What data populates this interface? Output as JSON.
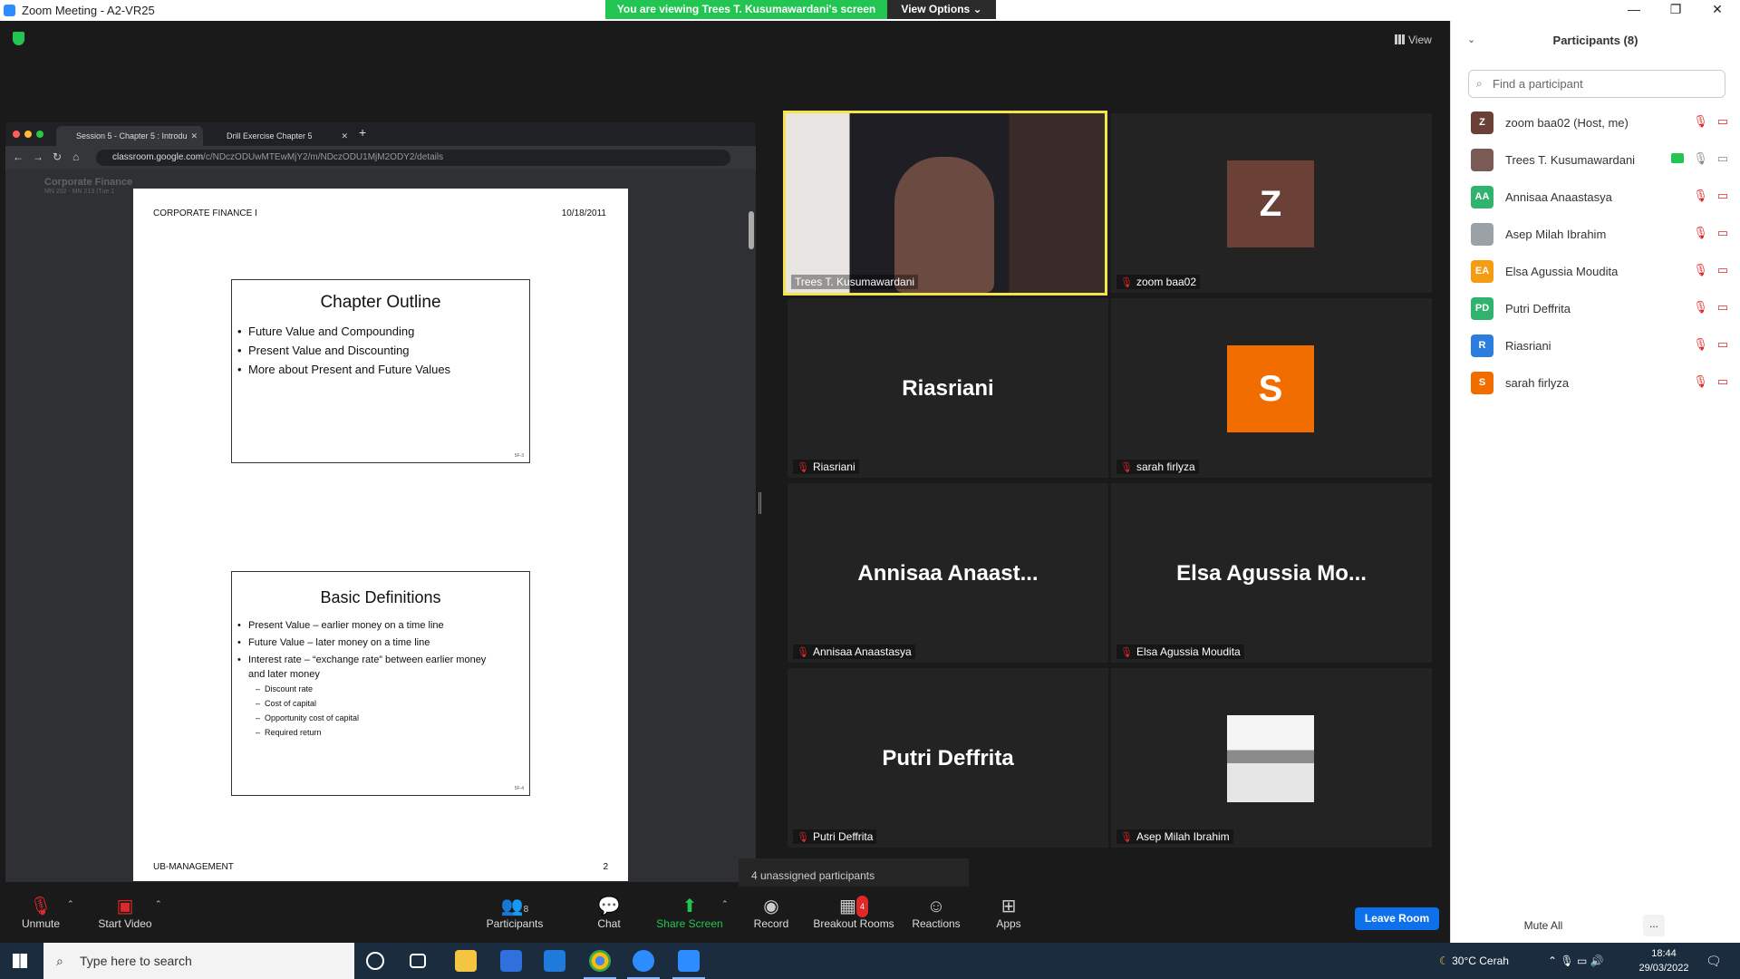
{
  "window": {
    "title": "Zoom Meeting - A2-VR25",
    "minimize": "—",
    "restore": "❐",
    "close": "✕"
  },
  "banner": {
    "viewing_text": "You are viewing Trees T. Kusumawardani's screen",
    "view_options": "View Options ⌄"
  },
  "view_button": "View",
  "shared_screen": {
    "tabs": [
      {
        "label": "Session 5 - Chapter 5 : Introdu",
        "close": "✕"
      },
      {
        "label": "Drill Exercise Chapter 5",
        "close": "✕"
      }
    ],
    "new_tab": "+",
    "url_host": "classroom.google.com",
    "url_path": "/c/NDczODUwMTEwMjY2/m/NDczODU1MjM2ODY2/details",
    "nav": {
      "back": "←",
      "forward": "→",
      "reload": "↻",
      "home": "⌂"
    },
    "course_title": "Corporate Finance",
    "course_sub": "MN 202 - MN 213 (Tue 1",
    "pdf": {
      "header_left": "CORPORATE FINANCE I",
      "header_right": "10/18/2011",
      "footer_left": "UB-MANAGEMENT",
      "footer_right": "2",
      "slide1": {
        "title": "Chapter Outline",
        "bullets": [
          "Future Value and Compounding",
          "Present Value and Discounting",
          "More about Present and Future Values"
        ],
        "num": "5F-3"
      },
      "slide2": {
        "title": "Basic Definitions",
        "bullets": [
          "Present Value – earlier money on a time line",
          "Future Value – later money on a time line",
          "Interest rate – “exchange rate” between earlier money and later money"
        ],
        "subs": [
          "Discount rate",
          "Cost of capital",
          "Opportunity cost of capital",
          "Required return"
        ],
        "num": "5F-4"
      }
    }
  },
  "gallery": [
    {
      "name": "Trees T. Kusumawardani",
      "type": "video"
    },
    {
      "name": "zoom baa02",
      "type": "avatar",
      "initial": "Z",
      "color": "#6b4036"
    },
    {
      "name": "Riasriani",
      "type": "bigname",
      "big": "Riasriani"
    },
    {
      "name": "sarah firlyza",
      "type": "avatar",
      "initial": "S",
      "color": "#f26d00"
    },
    {
      "name": "Annisaa Anaastasya",
      "type": "bigname",
      "big": "Annisaa  Anaast..."
    },
    {
      "name": "Elsa Agussia Moudita",
      "type": "bigname",
      "big": "Elsa  Agussia  Mo..."
    },
    {
      "name": "Putri Deffrita",
      "type": "bigname",
      "big": "Putri Deffrita"
    },
    {
      "name": "Asep Milah Ibrahim",
      "type": "photo"
    }
  ],
  "unassigned": "4 unassigned participants",
  "toolbar": {
    "unmute": "Unmute",
    "start_video": "Start Video",
    "participants": "Participants",
    "participants_count": "8",
    "chat": "Chat",
    "share_screen": "Share Screen",
    "record": "Record",
    "breakout_rooms": "Breakout Rooms",
    "breakout_badge": "4",
    "reactions": "Reactions",
    "apps": "Apps",
    "leave_room": "Leave Room"
  },
  "panel": {
    "title": "Participants (8)",
    "search_placeholder": "Find a participant",
    "participants": [
      {
        "name": "zoom baa02 (Host, me)",
        "initials": "Z",
        "color": "#6b4036"
      },
      {
        "name": "Trees T. Kusumawardani",
        "initials": "",
        "color": "#7a5a55",
        "sharing": true
      },
      {
        "name": "Annisaa Anaastasya",
        "initials": "AA",
        "color": "#2fb36f"
      },
      {
        "name": "Asep Milah Ibrahim",
        "initials": "",
        "color": "#9aa2a8"
      },
      {
        "name": "Elsa Agussia Moudita",
        "initials": "EA",
        "color": "#f59d12"
      },
      {
        "name": "Putri Deffrita",
        "initials": "PD",
        "color": "#2fb36f"
      },
      {
        "name": "Riasriani",
        "initials": "R",
        "color": "#2d7ddf"
      },
      {
        "name": "sarah firlyza",
        "initials": "S",
        "color": "#f26d00"
      }
    ],
    "mute_all": "Mute All",
    "more": "..."
  },
  "taskbar": {
    "search_placeholder": "Type here to search",
    "weather": "30°C  Cerah",
    "time": "18:44",
    "date": "29/03/2022"
  }
}
